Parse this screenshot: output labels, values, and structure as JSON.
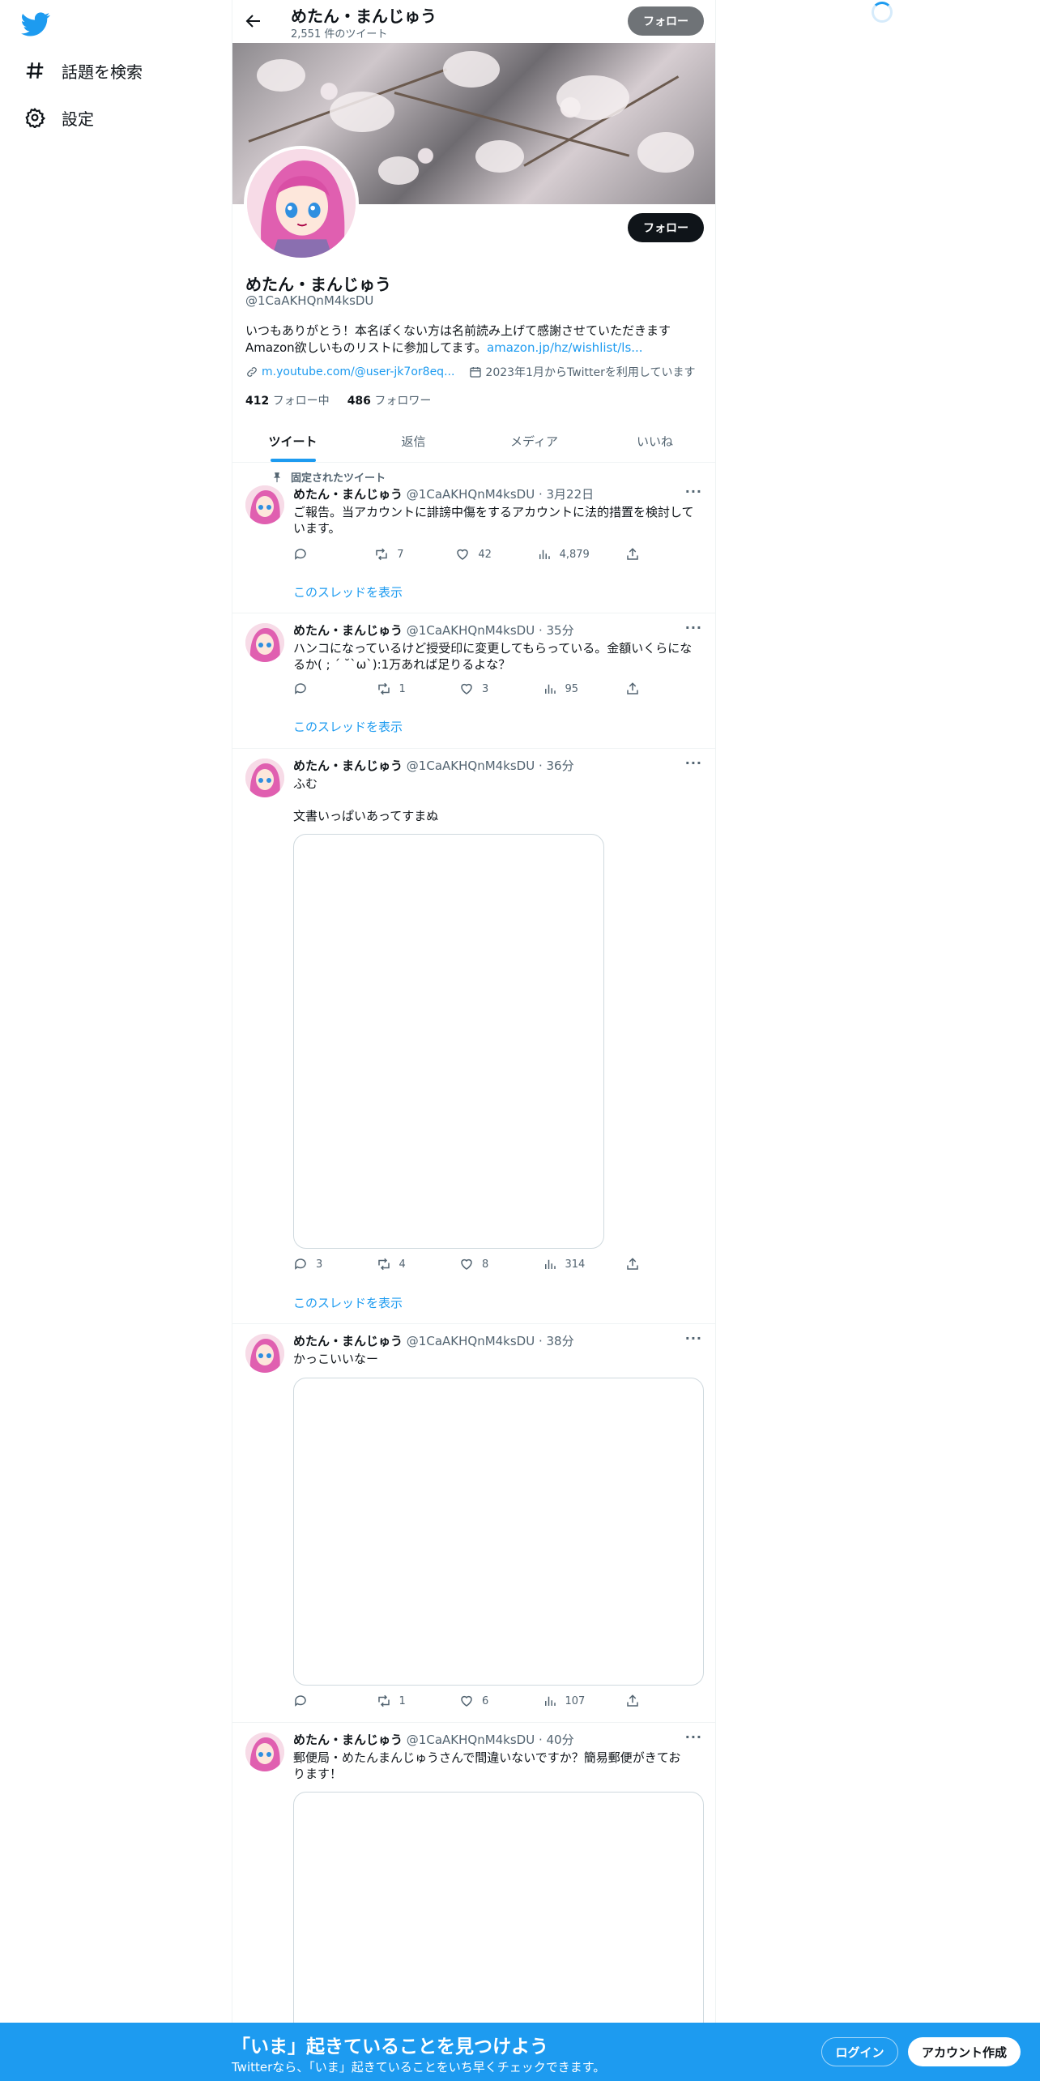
{
  "nav": {
    "logo": "twitter-bird-icon",
    "explore_label": "話題を検索",
    "settings_label": "設定"
  },
  "header": {
    "name": "めたん・まんじゅう",
    "tweet_count": "2,551 件のツイート",
    "follow_label": "フォロー"
  },
  "profile": {
    "follow_label": "フォロー",
    "name": "めたん・まんじゅう",
    "handle": "@1CaAKHQnM4ksDU",
    "bio_line1": "いつもありがとう！本名ぽくない方は名前読み上げて感謝させていただきます",
    "bio_line2_text": "Amazon欲しいものリストに参加してます。",
    "bio_line2_link": "amazon.jp/hz/wishlist/ls...",
    "website": "m.youtube.com/@user-jk7or8eq...",
    "joined": "2023年1月からTwitterを利用しています",
    "following_count": "412",
    "following_label": "フォロー中",
    "followers_count": "486",
    "followers_label": "フォロワー"
  },
  "tabs": [
    "ツイート",
    "返信",
    "メディア",
    "いいね"
  ],
  "tweets": [
    {
      "pinned_label": "固定されたツイート",
      "name": "めたん・まんじゅう",
      "handle_time": "@1CaAKHQnM4ksDU · 3月22日",
      "text_line1": "ご報告。当アカウントに誹謗中傷をするアカウントに法的措置を検討して",
      "text_line2": "います。",
      "replies": "",
      "retweets": "7",
      "likes": "42",
      "views": "4,879",
      "thread_label": "このスレッドを表示"
    },
    {
      "name": "めたん・まんじゅう",
      "handle_time": "@1CaAKHQnM4ksDU · 35分",
      "text_line1": "ハンコになっているけど授受印に変更してもらっている。金額いくらにな",
      "text_line2": "るか( ; ´ ˘`ω`):1万あれば足りるよな？",
      "replies": "",
      "retweets": "1",
      "likes": "3",
      "views": "95",
      "thread_label": "このスレッドを表示"
    },
    {
      "name": "めたん・まんじゅう",
      "handle_time": "@1CaAKHQnM4ksDU · 36分",
      "text_line1": "ふむ",
      "text_line2": "文書いっぱいあってすまぬ",
      "replies": "3",
      "retweets": "4",
      "likes": "8",
      "views": "314",
      "thread_label": "このスレッドを表示"
    },
    {
      "name": "めたん・まんじゅう",
      "handle_time": "@1CaAKHQnM4ksDU · 38分",
      "text_line1": "かっこいいなー",
      "replies": "",
      "retweets": "1",
      "likes": "6",
      "views": "107"
    },
    {
      "name": "めたん・まんじゅう",
      "handle_time": "@1CaAKHQnM4ksDU · 40分",
      "text_line1": "郵便局・めたんまんじゅうさんで間違いないですか？簡易郵便がきてお",
      "text_line2": "ります！"
    }
  ],
  "bottom": {
    "title": "「いま」起きていることを見つけよう",
    "subtitle": "Twitterなら、「いま」起きていることをいち早くチェックできます。",
    "login_label": "ログイン",
    "signup_label": "アカウント作成"
  },
  "colors": {
    "accent": "#1d9bf0",
    "text": "#0f1419",
    "muted": "#536471",
    "border": "#eff3f4"
  }
}
